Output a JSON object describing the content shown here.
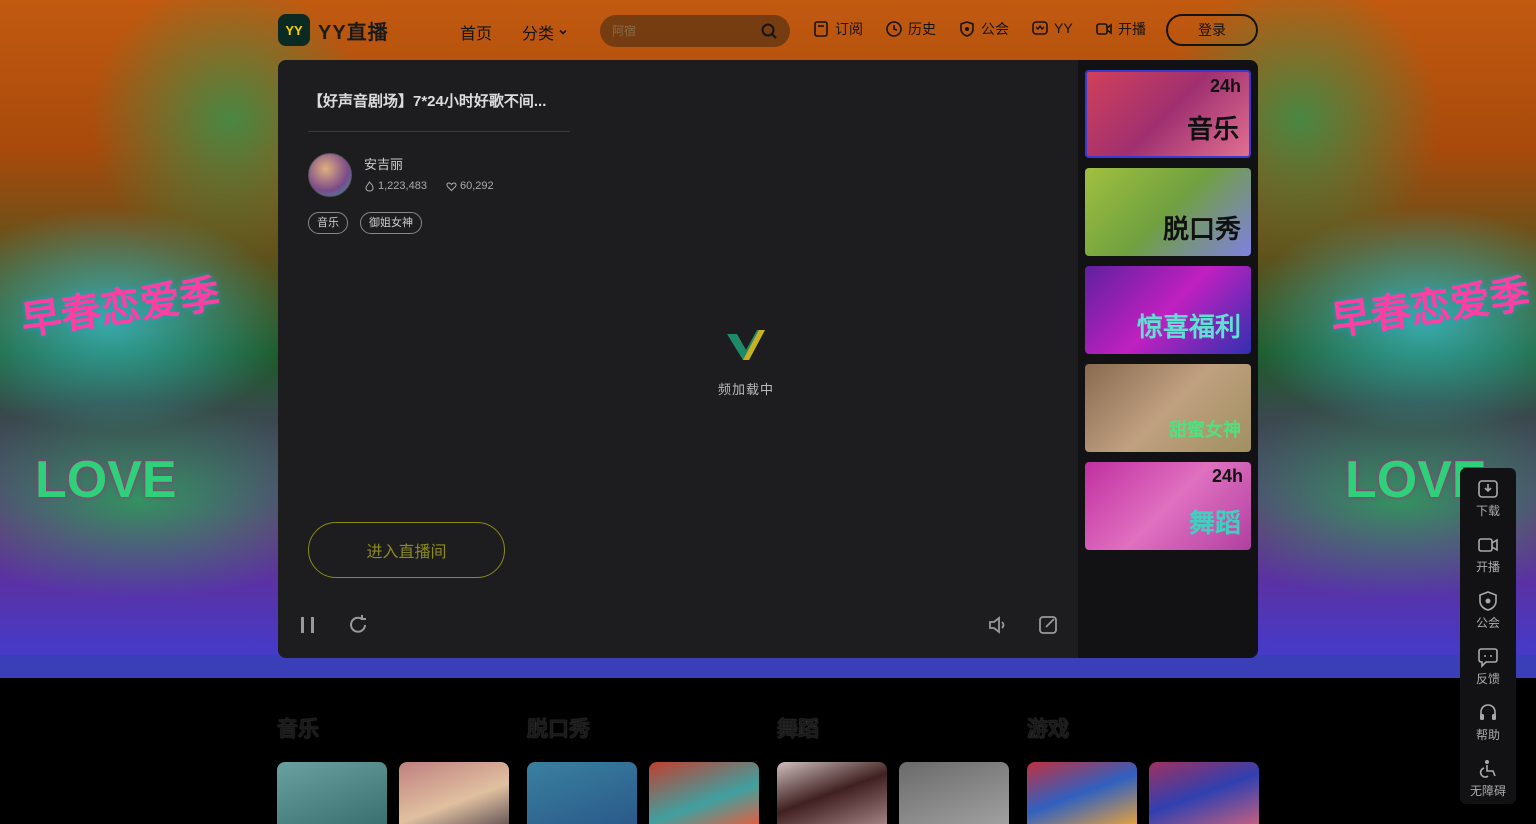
{
  "brand": {
    "logo_text": "YY直播",
    "mark": "YY"
  },
  "nav": {
    "home": "首页",
    "category": "分类",
    "search_placeholder": "阿宿",
    "items": [
      "订阅",
      "历史",
      "公会",
      "YY",
      "开播"
    ],
    "login": "登录"
  },
  "hero_art": {
    "left_title": "早春恋爱季",
    "right_title": "早春恋爱季",
    "love": "LOVE"
  },
  "room": {
    "title": "【好声音剧场】7*24小时好歌不间...",
    "anchor_name": "安吉丽",
    "viewers": "1,223,483",
    "likes": "60,292",
    "tags": [
      "音乐",
      "御姐女神"
    ],
    "loading_text": "频加载中",
    "enter_button": "进入直播间"
  },
  "side_thumbs": [
    {
      "badge": "24h",
      "caption": "音乐"
    },
    {
      "badge": "",
      "caption": "脱口秀"
    },
    {
      "badge": "",
      "caption": "惊喜福利"
    },
    {
      "badge": "",
      "caption": "甜蜜女神"
    },
    {
      "badge": "24h",
      "caption": "舞蹈"
    }
  ],
  "sections": [
    "音乐",
    "脱口秀",
    "舞蹈",
    "游戏"
  ],
  "float_bar": [
    "下载",
    "开播",
    "公会",
    "反馈",
    "帮助",
    "无障碍"
  ]
}
